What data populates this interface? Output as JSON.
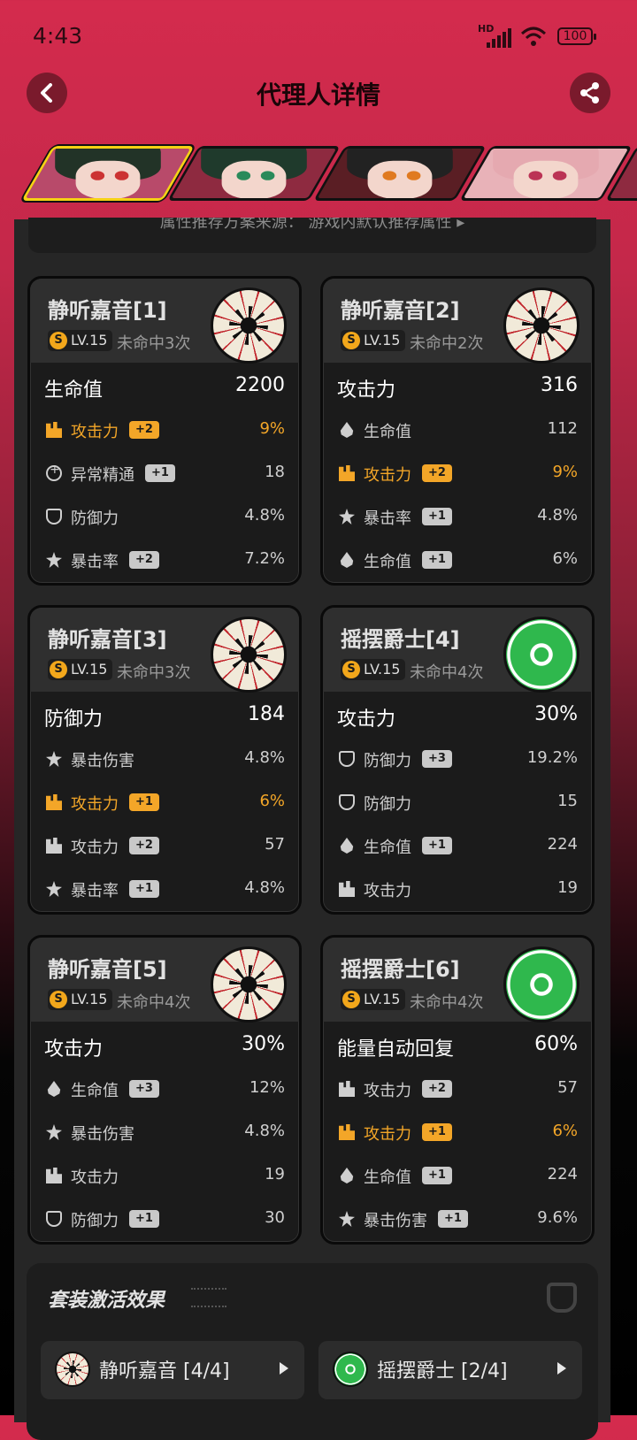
{
  "status": {
    "time": "4:43",
    "network": "HD",
    "battery": "100"
  },
  "header": {
    "title": "代理人详情"
  },
  "banner": {
    "text": "属性推荐方案来源：  游戏内默认推荐属性 ▸"
  },
  "cards": [
    {
      "name": "静听嘉音[1]",
      "level": "LV.15",
      "miss": "未命中3次",
      "disc": "red",
      "main": {
        "label": "生命值",
        "value": "2200"
      },
      "subs": [
        {
          "icon": "attack-icon",
          "label": "攻击力",
          "badge": "+2",
          "value": "9%",
          "hl": true
        },
        {
          "icon": "anomaly-icon",
          "label": "异常精通",
          "badge": "+1",
          "value": "18",
          "hl": false
        },
        {
          "icon": "defense-icon",
          "label": "防御力",
          "badge": "",
          "value": "4.8%",
          "hl": false
        },
        {
          "icon": "crit-icon",
          "label": "暴击率",
          "badge": "+2",
          "value": "7.2%",
          "hl": false
        }
      ]
    },
    {
      "name": "静听嘉音[2]",
      "level": "LV.15",
      "miss": "未命中2次",
      "disc": "red",
      "main": {
        "label": "攻击力",
        "value": "316"
      },
      "subs": [
        {
          "icon": "hp-icon",
          "label": "生命值",
          "badge": "",
          "value": "112",
          "hl": false
        },
        {
          "icon": "attack-icon",
          "label": "攻击力",
          "badge": "+2",
          "value": "9%",
          "hl": true
        },
        {
          "icon": "crit-icon",
          "label": "暴击率",
          "badge": "+1",
          "value": "4.8%",
          "hl": false
        },
        {
          "icon": "hp-icon",
          "label": "生命值",
          "badge": "+1",
          "value": "6%",
          "hl": false
        }
      ]
    },
    {
      "name": "静听嘉音[3]",
      "level": "LV.15",
      "miss": "未命中3次",
      "disc": "red",
      "main": {
        "label": "防御力",
        "value": "184"
      },
      "subs": [
        {
          "icon": "crit-icon",
          "label": "暴击伤害",
          "badge": "",
          "value": "4.8%",
          "hl": false
        },
        {
          "icon": "attack-icon",
          "label": "攻击力",
          "badge": "+1",
          "value": "6%",
          "hl": true
        },
        {
          "icon": "attack-icon",
          "label": "攻击力",
          "badge": "+2",
          "value": "57",
          "hl": false
        },
        {
          "icon": "crit-icon",
          "label": "暴击率",
          "badge": "+1",
          "value": "4.8%",
          "hl": false
        }
      ]
    },
    {
      "name": "摇摆爵士[4]",
      "level": "LV.15",
      "miss": "未命中4次",
      "disc": "green",
      "main": {
        "label": "攻击力",
        "value": "30%"
      },
      "subs": [
        {
          "icon": "defense-icon",
          "label": "防御力",
          "badge": "+3",
          "value": "19.2%",
          "hl": false
        },
        {
          "icon": "defense-icon",
          "label": "防御力",
          "badge": "",
          "value": "15",
          "hl": false
        },
        {
          "icon": "hp-icon",
          "label": "生命值",
          "badge": "+1",
          "value": "224",
          "hl": false
        },
        {
          "icon": "attack-icon",
          "label": "攻击力",
          "badge": "",
          "value": "19",
          "hl": false
        }
      ]
    },
    {
      "name": "静听嘉音[5]",
      "level": "LV.15",
      "miss": "未命中4次",
      "disc": "red",
      "main": {
        "label": "攻击力",
        "value": "30%"
      },
      "subs": [
        {
          "icon": "hp-icon",
          "label": "生命值",
          "badge": "+3",
          "value": "12%",
          "hl": false
        },
        {
          "icon": "crit-icon",
          "label": "暴击伤害",
          "badge": "",
          "value": "4.8%",
          "hl": false
        },
        {
          "icon": "attack-icon",
          "label": "攻击力",
          "badge": "",
          "value": "19",
          "hl": false
        },
        {
          "icon": "defense-icon",
          "label": "防御力",
          "badge": "+1",
          "value": "30",
          "hl": false
        }
      ]
    },
    {
      "name": "摇摆爵士[6]",
      "level": "LV.15",
      "miss": "未命中4次",
      "disc": "green",
      "main": {
        "label": "能量自动回复",
        "value": "60%"
      },
      "subs": [
        {
          "icon": "attack-icon",
          "label": "攻击力",
          "badge": "+2",
          "value": "57",
          "hl": false
        },
        {
          "icon": "attack-icon",
          "label": "攻击力",
          "badge": "+1",
          "value": "6%",
          "hl": true
        },
        {
          "icon": "hp-icon",
          "label": "生命值",
          "badge": "+1",
          "value": "224",
          "hl": false
        },
        {
          "icon": "crit-icon",
          "label": "暴击伤害",
          "badge": "+1",
          "value": "9.6%",
          "hl": false
        }
      ]
    }
  ],
  "set_effect": {
    "title": "套装激活效果",
    "items": [
      {
        "label": "静听嘉音 [4/4]",
        "disc": "red"
      },
      {
        "label": "摇摆爵士 [2/4]",
        "disc": "green"
      }
    ]
  },
  "colors": {
    "accent": "#d42b4d",
    "highlight": "#f3a628",
    "card_bg": "#1b1b1b"
  }
}
